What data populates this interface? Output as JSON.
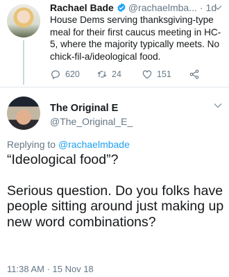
{
  "tweet": {
    "author_name": "Rachael Bade",
    "author_handle": "@rachaelmba...",
    "separator": "·",
    "time": "1d",
    "text": "House Dems serving thanksgiving-type meal for their first caucus meeting in HC-5, where the majority typically meets. No chick-fil-a/ideological food.",
    "replies": "620",
    "retweets": "24",
    "likes": "151",
    "verified_color": "#1da1f2"
  },
  "reply": {
    "author_name": "The Original E",
    "author_handle": "@The_Original_E_",
    "replying_prefix": "Replying to",
    "replying_to": "@rachaelmbade",
    "paragraph1": "“Ideological food”?",
    "paragraph2": "Serious question. Do you folks have people sitting around just making up new word combinations?",
    "timestamp": "11:38 AM · 15 Nov 18"
  },
  "colors": {
    "text": "#14171a",
    "secondary": "#657786",
    "link": "#1da1f2",
    "divider": "#e1e8ed"
  },
  "icons": [
    "verified-badge-icon",
    "chevron-down-icon",
    "reply-icon",
    "retweet-icon",
    "like-icon",
    "share-icon"
  ]
}
